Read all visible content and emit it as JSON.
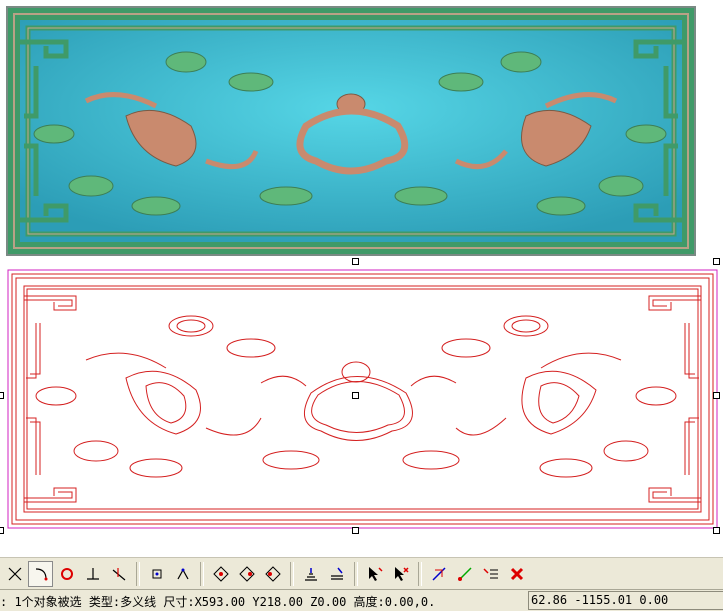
{
  "colors": {
    "relief_background": "#36b6cc",
    "relief_frame": "#3f9a68",
    "relief_ornament": "#c98a6e",
    "vector_line": "#d42020",
    "selection_outline": "#d020c0"
  },
  "toolbar": {
    "buttons": [
      {
        "icon": "trim-icon"
      },
      {
        "icon": "fillet-icon"
      },
      {
        "icon": "circle-snap-icon"
      },
      {
        "icon": "perpendicular-icon"
      },
      {
        "icon": "extend-icon"
      },
      {
        "icon": "node-select-icon"
      },
      {
        "icon": "vertex-icon"
      },
      {
        "icon": "node-edit-icon"
      },
      {
        "icon": "node-add-icon"
      },
      {
        "icon": "node-delete-icon"
      },
      {
        "icon": "align-bottom-icon"
      },
      {
        "icon": "align-lines-icon"
      },
      {
        "icon": "cursor-add-icon"
      },
      {
        "icon": "cursor-remove-icon"
      },
      {
        "icon": "transform-icon"
      },
      {
        "icon": "path-edit-icon"
      },
      {
        "icon": "list-edit-icon"
      },
      {
        "icon": "close-icon"
      }
    ]
  },
  "status": {
    "message": ": 1个对象被选 类型:多义线 尺寸:X593.00 Y218.00 Z0.00 高度:0.00,0.",
    "coordinates": "62.86 -1155.01 0.00"
  }
}
